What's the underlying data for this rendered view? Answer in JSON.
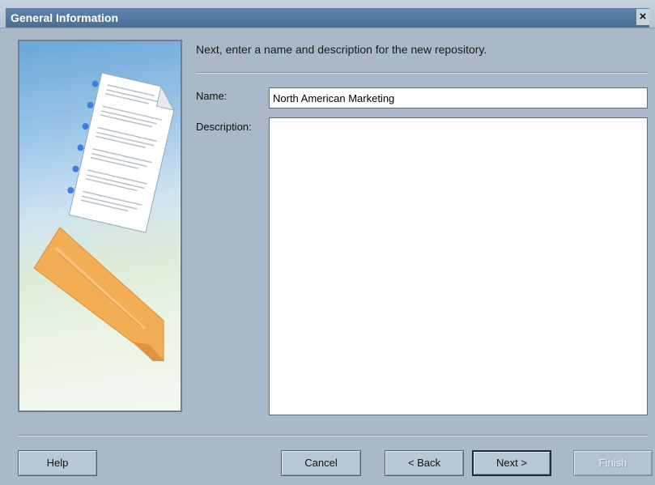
{
  "window": {
    "title": "General Information",
    "close_glyph": "×"
  },
  "instruction": "Next, enter a name and description for the new repository.",
  "form": {
    "name_label": "Name:",
    "name_value": "North American Marketing",
    "description_label": "Description:",
    "description_value": ""
  },
  "buttons": {
    "help": "Help",
    "cancel": "Cancel",
    "back": "< Back",
    "next": "Next >",
    "finish": "Finish"
  },
  "colors": {
    "title_bar": "#4a6f95",
    "dialog_bg": "#a9b9c8",
    "ribbon": "#f2ad55",
    "bullet": "#3b7ee0"
  },
  "icons": {
    "side_art": "document-list-and-ribbon-illustration"
  }
}
